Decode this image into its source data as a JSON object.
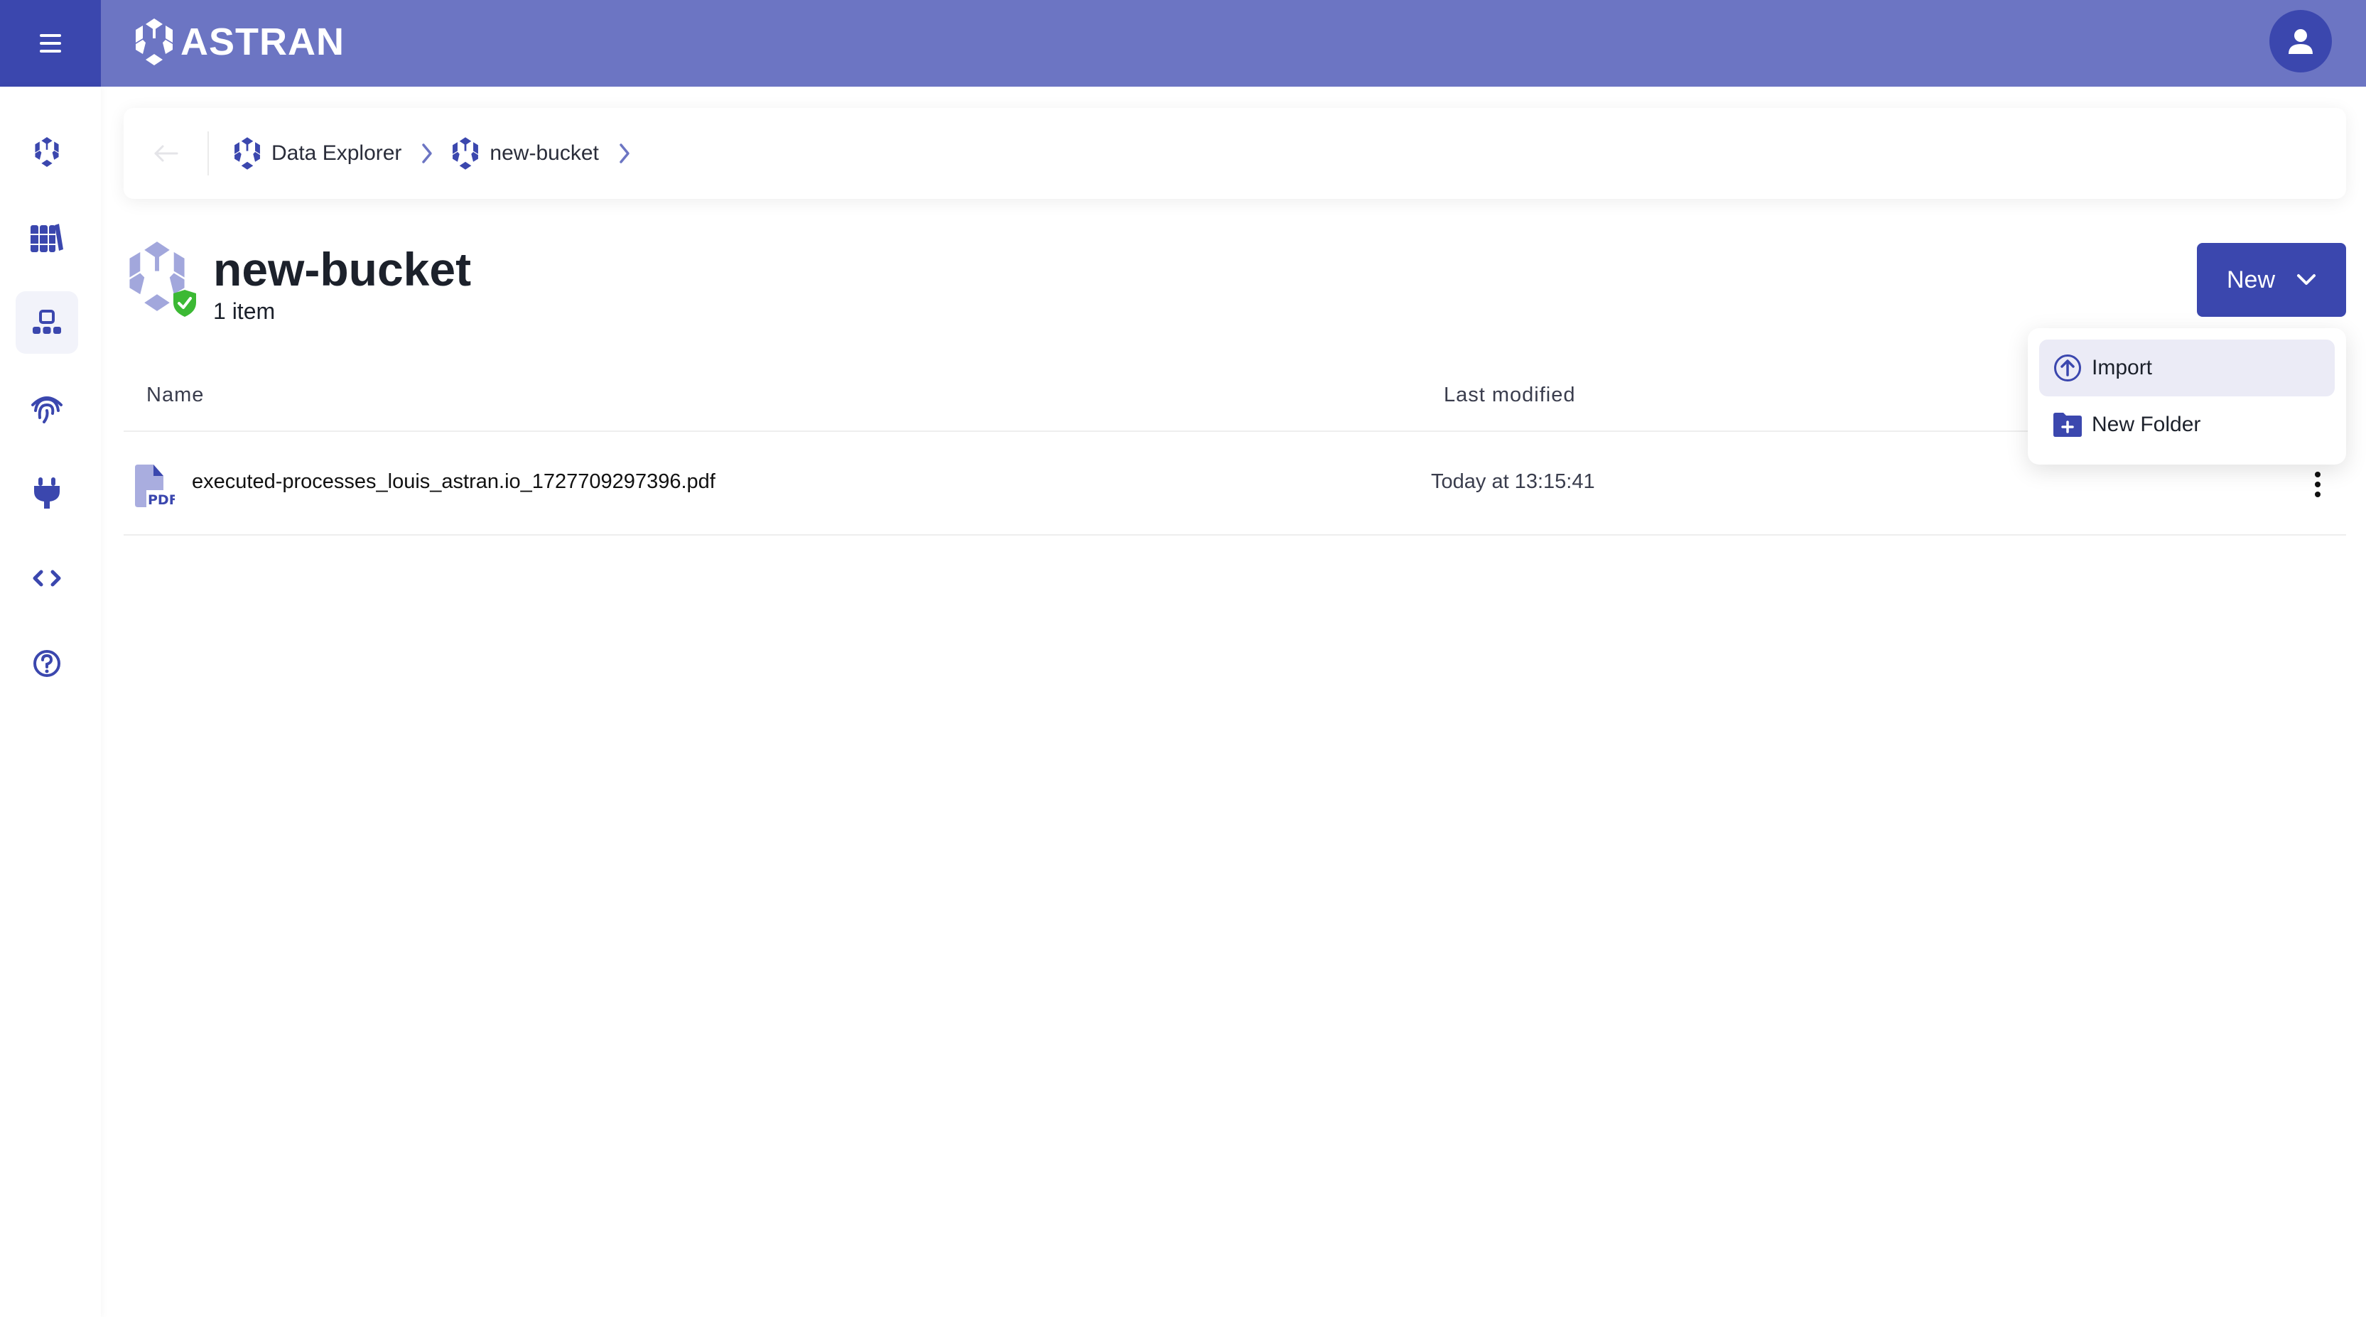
{
  "app": {
    "brand": "ASTRAN",
    "colors": {
      "primary": "#3b47ae",
      "header": "#6c75c3",
      "success": "#3cb934"
    }
  },
  "topbar": {
    "menu_icon": "hamburger-icon",
    "user_icon": "user-avatar-icon"
  },
  "sidebar": {
    "items": [
      {
        "icon": "astran-hex-icon",
        "active": false
      },
      {
        "icon": "library-books-icon",
        "active": false
      },
      {
        "icon": "data-explorer-sitemap-icon",
        "active": true
      },
      {
        "icon": "fingerprint-icon",
        "active": false
      },
      {
        "icon": "plug-icon",
        "active": false
      },
      {
        "icon": "code-brackets-icon",
        "active": false
      },
      {
        "icon": "help-circle-icon",
        "active": false
      }
    ]
  },
  "breadcrumb": {
    "items": [
      {
        "label": "Data Explorer"
      },
      {
        "label": "new-bucket"
      }
    ]
  },
  "page": {
    "title": "new-bucket",
    "subtitle": "1 item",
    "new_button": "New"
  },
  "new_menu": {
    "items": [
      {
        "label": "Import",
        "icon": "upload-circle-icon"
      },
      {
        "label": "New Folder",
        "icon": "folder-plus-icon"
      }
    ]
  },
  "table": {
    "columns": [
      "Name",
      "Last modified"
    ],
    "rows": [
      {
        "name": "executed-processes_louis_astran.io_1727709297396.pdf",
        "modified": "Today at 13:15:41",
        "type": "PDF"
      }
    ]
  }
}
